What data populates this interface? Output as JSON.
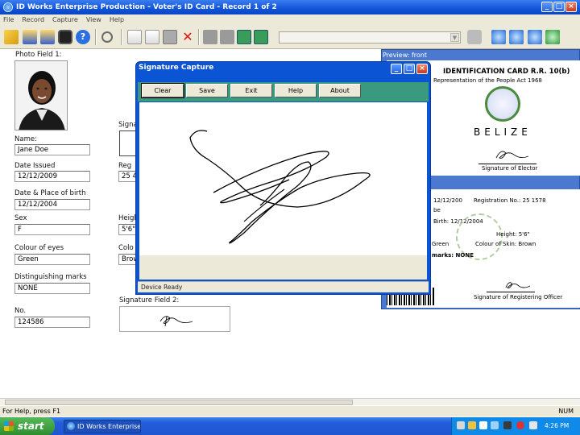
{
  "window": {
    "title": "ID Works Enterprise Production - Voter's ID Card - Record 1 of 2"
  },
  "menu": [
    "File",
    "Record",
    "Capture",
    "View",
    "Help"
  ],
  "toolbar": {
    "combo_value": ""
  },
  "form": {
    "photo_label": "Photo Field 1:",
    "name_label": "Name:",
    "name_value": "Jane Doe",
    "date_issued_label": "Date Issued",
    "date_issued_value": "12/12/2009",
    "dob_label": "Date & Place of birth",
    "dob_value": "12/12/2004",
    "sex_label": "Sex",
    "sex_value": "F",
    "eyes_label": "Colour of eyes",
    "eyes_value": "Green",
    "marks_label": "Distinguishing marks",
    "marks_value": "NONE",
    "no_label": "No.",
    "no_value": "124586",
    "sig_label": "Signa",
    "reg_label": "Reg",
    "reg_value": "25 4",
    "height_label": "Heigh",
    "height_value": "5'6\"",
    "colour_label": "Colo",
    "colour_value": "Brow",
    "sig2_label": "Signature Field 2:"
  },
  "preview": {
    "title": "Preview: front",
    "front_title": "IDENTIFICATION CARD R.R. 10(b)",
    "front_sub": "Representation of the People Act 1968",
    "country": "BELIZE",
    "sig_caption": "Signature of Elector",
    "back_date": "12/12/200",
    "back_reg": "Registration No.: 25 1578",
    "back_birth": "Birth: 12/12/2004",
    "back_height": "Height: 5'6\"",
    "back_eyes_short": "Green",
    "back_skin": "Colour of Skin: Brown",
    "back_marks": "marks: NONE",
    "back_caption": "Signature of Registering Officer"
  },
  "dialog": {
    "title": "Signature Capture",
    "buttons": [
      "Clear",
      "Save",
      "Exit",
      "Help",
      "About"
    ],
    "status": "Device Ready"
  },
  "status_bar": {
    "text": "For Help, press F1",
    "num": "NUM"
  },
  "taskbar": {
    "start": "start",
    "task": "ID Works Enterprise ...",
    "clock": "4:26 PM"
  }
}
